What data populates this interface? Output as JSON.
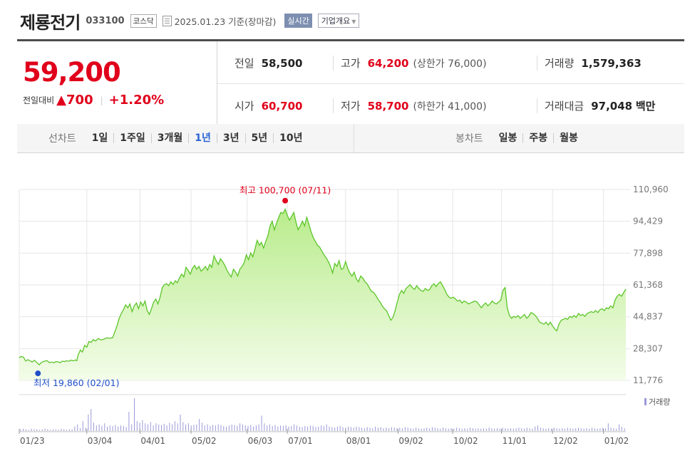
{
  "header": {
    "company": "제룡전기",
    "code": "033100",
    "market": "코스닥",
    "date": "2025.01.23 기준(장마감)",
    "realtime": "실시간",
    "company_info": "기업개요"
  },
  "quote": {
    "price": "59,200",
    "change_label": "전일대비",
    "change_value": "700",
    "change_pct": "+1.20%",
    "prev_close": {
      "label": "전일",
      "value": "58,500"
    },
    "high": {
      "label": "고가",
      "value": "64,200",
      "limit_label": "상한가",
      "limit_value": "76,000"
    },
    "volume": {
      "label": "거래량",
      "value": "1,579,363"
    },
    "open": {
      "label": "시가",
      "value": "60,700"
    },
    "low": {
      "label": "저가",
      "value": "58,700",
      "limit_label": "하한가",
      "limit_value": "41,000"
    },
    "amount": {
      "label": "거래대금",
      "value": "97,048",
      "unit": "백만"
    }
  },
  "periods": {
    "line_label": "선차트",
    "line_options": [
      "1일",
      "1주일",
      "3개월",
      "1년",
      "3년",
      "5년",
      "10년"
    ],
    "line_selected": 3,
    "candle_label": "봉차트",
    "candle_options": [
      "일봉",
      "주봉",
      "월봉"
    ]
  },
  "chart_data": {
    "type": "area",
    "x_ticks": [
      "01/23",
      "03/04",
      "04/01",
      "05/02",
      "06/03",
      "07/01",
      "08/01",
      "09/02",
      "10/02",
      "11/01",
      "12/02",
      "01/02"
    ],
    "y_ticks": [
      110960,
      94429,
      77898,
      61368,
      44837,
      28307,
      11776
    ],
    "ylim": [
      11776,
      110960
    ],
    "high_label": "최고 100,700 (07/11)",
    "low_label": "최저 19,860 (02/01)",
    "volume_label": "거래량",
    "colors": {
      "line": "#5cc52a",
      "fill_top": "#b9ec8c",
      "fill_bottom": "#f3fce9",
      "high": "#e0001b",
      "low": "#1f4fc9",
      "volume": "#9a9ad8",
      "grid": "#e6e6e6"
    },
    "points": [
      [
        0,
        23500
      ],
      [
        3,
        24200
      ],
      [
        6,
        23800
      ],
      [
        9,
        21800
      ],
      [
        12,
        22500
      ],
      [
        15,
        22000
      ],
      [
        18,
        21300
      ],
      [
        21,
        22200
      ],
      [
        24,
        21200
      ],
      [
        26,
        20400
      ],
      [
        28,
        19860
      ],
      [
        30,
        20800
      ],
      [
        33,
        21500
      ],
      [
        36,
        21800
      ],
      [
        39,
        22000
      ],
      [
        42,
        21000
      ],
      [
        45,
        21300
      ],
      [
        48,
        20900
      ],
      [
        51,
        21500
      ],
      [
        54,
        21400
      ],
      [
        57,
        21000
      ],
      [
        60,
        21800
      ],
      [
        63,
        21500
      ],
      [
        66,
        22000
      ],
      [
        69,
        21700
      ],
      [
        72,
        22300
      ],
      [
        75,
        21900
      ],
      [
        78,
        22400
      ],
      [
        80,
        22000
      ],
      [
        82,
        25000
      ],
      [
        85,
        27500
      ],
      [
        88,
        26500
      ],
      [
        91,
        30000
      ],
      [
        94,
        29000
      ],
      [
        97,
        32000
      ],
      [
        100,
        31500
      ],
      [
        103,
        33000
      ],
      [
        106,
        32200
      ],
      [
        110,
        33500
      ],
      [
        114,
        32800
      ],
      [
        118,
        33200
      ],
      [
        122,
        33900
      ],
      [
        126,
        33600
      ],
      [
        130,
        34000
      ],
      [
        133,
        37000
      ],
      [
        136,
        40000
      ],
      [
        139,
        44000
      ],
      [
        142,
        46500
      ],
      [
        145,
        48500
      ],
      [
        148,
        51000
      ],
      [
        151,
        49500
      ],
      [
        154,
        51500
      ],
      [
        157,
        47500
      ],
      [
        160,
        50500
      ],
      [
        163,
        52000
      ],
      [
        166,
        49000
      ],
      [
        169,
        52500
      ],
      [
        172,
        50500
      ],
      [
        175,
        53000
      ],
      [
        178,
        48000
      ],
      [
        181,
        46000
      ],
      [
        184,
        49000
      ],
      [
        187,
        52500
      ],
      [
        190,
        54000
      ],
      [
        193,
        51500
      ],
      [
        196,
        55000
      ],
      [
        199,
        60000
      ],
      [
        202,
        61500
      ],
      [
        205,
        62000
      ],
      [
        208,
        61000
      ],
      [
        211,
        63000
      ],
      [
        214,
        61500
      ],
      [
        217,
        63500
      ],
      [
        220,
        62500
      ],
      [
        223,
        65000
      ],
      [
        226,
        67000
      ],
      [
        229,
        65500
      ],
      [
        232,
        70500
      ],
      [
        235,
        69000
      ],
      [
        238,
        67000
      ],
      [
        241,
        70000
      ],
      [
        244,
        71500
      ],
      [
        247,
        69500
      ],
      [
        250,
        71000
      ],
      [
        253,
        68500
      ],
      [
        256,
        69500
      ],
      [
        259,
        71000
      ],
      [
        262,
        69000
      ],
      [
        265,
        72000
      ],
      [
        268,
        70500
      ],
      [
        271,
        76500
      ],
      [
        274,
        74000
      ],
      [
        277,
        72000
      ],
      [
        280,
        75000
      ],
      [
        283,
        73500
      ],
      [
        286,
        71500
      ],
      [
        289,
        69000
      ],
      [
        292,
        67000
      ],
      [
        295,
        65500
      ],
      [
        298,
        69500
      ],
      [
        301,
        68000
      ],
      [
        304,
        66000
      ],
      [
        307,
        69500
      ],
      [
        310,
        71000
      ],
      [
        313,
        73000
      ],
      [
        316,
        77000
      ],
      [
        319,
        74500
      ],
      [
        322,
        78000
      ],
      [
        325,
        76000
      ],
      [
        328,
        80000
      ],
      [
        331,
        84500
      ],
      [
        334,
        82000
      ],
      [
        337,
        83500
      ],
      [
        340,
        80500
      ],
      [
        343,
        84000
      ],
      [
        346,
        87000
      ],
      [
        349,
        92000
      ],
      [
        352,
        94500
      ],
      [
        355,
        90000
      ],
      [
        358,
        93500
      ],
      [
        361,
        96500
      ],
      [
        364,
        99000
      ],
      [
        367,
        98500
      ],
      [
        370,
        100700
      ],
      [
        373,
        97500
      ],
      [
        376,
        95000
      ],
      [
        379,
        97000
      ],
      [
        382,
        99000
      ],
      [
        385,
        94000
      ],
      [
        388,
        90000
      ],
      [
        391,
        92000
      ],
      [
        394,
        94500
      ],
      [
        397,
        92000
      ],
      [
        400,
        96500
      ],
      [
        403,
        93000
      ],
      [
        406,
        89000
      ],
      [
        409,
        86000
      ],
      [
        412,
        84000
      ],
      [
        415,
        82000
      ],
      [
        418,
        81000
      ],
      [
        421,
        79000
      ],
      [
        424,
        77000
      ],
      [
        427,
        75500
      ],
      [
        430,
        73500
      ],
      [
        433,
        71000
      ],
      [
        436,
        67500
      ],
      [
        439,
        72500
      ],
      [
        442,
        71000
      ],
      [
        445,
        74000
      ],
      [
        448,
        69500
      ],
      [
        451,
        70000
      ],
      [
        454,
        73500
      ],
      [
        457,
        70000
      ],
      [
        460,
        67500
      ],
      [
        463,
        66000
      ],
      [
        466,
        68000
      ],
      [
        469,
        64500
      ],
      [
        472,
        63000
      ],
      [
        475,
        66000
      ],
      [
        478,
        65000
      ],
      [
        481,
        63000
      ],
      [
        484,
        62000
      ],
      [
        487,
        60000
      ],
      [
        490,
        58000
      ],
      [
        493,
        57500
      ],
      [
        496,
        56000
      ],
      [
        499,
        54000
      ],
      [
        502,
        52500
      ],
      [
        505,
        50500
      ],
      [
        508,
        49000
      ],
      [
        511,
        48000
      ],
      [
        514,
        45500
      ],
      [
        517,
        43000
      ],
      [
        520,
        44500
      ],
      [
        523,
        48000
      ],
      [
        526,
        52500
      ],
      [
        529,
        56500
      ],
      [
        532,
        58500
      ],
      [
        535,
        57000
      ],
      [
        538,
        59500
      ],
      [
        541,
        60500
      ],
      [
        544,
        61500
      ],
      [
        547,
        60000
      ],
      [
        550,
        59000
      ],
      [
        553,
        61000
      ],
      [
        556,
        59500
      ],
      [
        559,
        58500
      ],
      [
        562,
        58000
      ],
      [
        565,
        59500
      ],
      [
        568,
        58500
      ],
      [
        571,
        59000
      ],
      [
        574,
        61000
      ],
      [
        577,
        62000
      ],
      [
        580,
        60500
      ],
      [
        583,
        62000
      ],
      [
        586,
        63000
      ],
      [
        589,
        61000
      ],
      [
        592,
        59000
      ],
      [
        595,
        56500
      ],
      [
        598,
        55000
      ],
      [
        601,
        54500
      ],
      [
        604,
        55000
      ],
      [
        607,
        54000
      ],
      [
        610,
        53000
      ],
      [
        613,
        53500
      ],
      [
        616,
        52000
      ],
      [
        619,
        53000
      ],
      [
        622,
        52500
      ],
      [
        625,
        51500
      ],
      [
        628,
        52000
      ],
      [
        631,
        52500
      ],
      [
        634,
        53000
      ],
      [
        637,
        52500
      ],
      [
        640,
        51000
      ],
      [
        643,
        49500
      ],
      [
        646,
        51000
      ],
      [
        649,
        52000
      ],
      [
        652,
        50500
      ],
      [
        655,
        51500
      ],
      [
        658,
        53000
      ],
      [
        661,
        52000
      ],
      [
        664,
        51500
      ],
      [
        667,
        52500
      ],
      [
        670,
        53500
      ],
      [
        673,
        58500
      ],
      [
        676,
        60000
      ],
      [
        679,
        49500
      ],
      [
        682,
        45500
      ],
      [
        685,
        44000
      ],
      [
        688,
        45000
      ],
      [
        691,
        44500
      ],
      [
        694,
        45500
      ],
      [
        697,
        44000
      ],
      [
        700,
        45000
      ],
      [
        703,
        46000
      ],
      [
        706,
        44000
      ],
      [
        709,
        45000
      ],
      [
        712,
        47000
      ],
      [
        715,
        46500
      ],
      [
        718,
        45500
      ],
      [
        721,
        44000
      ],
      [
        724,
        42000
      ],
      [
        727,
        41500
      ],
      [
        730,
        41000
      ],
      [
        733,
        42000
      ],
      [
        736,
        40500
      ],
      [
        739,
        42000
      ],
      [
        742,
        40000
      ],
      [
        745,
        38500
      ],
      [
        748,
        37500
      ],
      [
        751,
        41000
      ],
      [
        754,
        43000
      ],
      [
        757,
        43500
      ],
      [
        760,
        44000
      ],
      [
        763,
        43500
      ],
      [
        766,
        45000
      ],
      [
        769,
        44500
      ],
      [
        772,
        45500
      ],
      [
        775,
        44500
      ],
      [
        778,
        46500
      ],
      [
        781,
        45500
      ],
      [
        784,
        46000
      ],
      [
        787,
        45000
      ],
      [
        790,
        46500
      ],
      [
        793,
        47000
      ],
      [
        796,
        47500
      ],
      [
        799,
        47000
      ],
      [
        802,
        48000
      ],
      [
        805,
        47000
      ],
      [
        808,
        48500
      ],
      [
        811,
        49000
      ],
      [
        814,
        48000
      ],
      [
        817,
        49500
      ],
      [
        820,
        49000
      ],
      [
        823,
        50500
      ],
      [
        826,
        49500
      ],
      [
        829,
        53500
      ],
      [
        832,
        55500
      ],
      [
        835,
        56500
      ],
      [
        838,
        55500
      ],
      [
        841,
        57500
      ],
      [
        844,
        59200
      ]
    ],
    "volumes": [
      3,
      4,
      3,
      2,
      4,
      3,
      3,
      2,
      3,
      4,
      3,
      2,
      3,
      3,
      2,
      4,
      3,
      2,
      3,
      3,
      8,
      12,
      5,
      18,
      6,
      30,
      40,
      15,
      10,
      12,
      9,
      14,
      8,
      10,
      9,
      11,
      8,
      10,
      9,
      7,
      35,
      12,
      60,
      18,
      15,
      20,
      14,
      12,
      16,
      10,
      14,
      12,
      11,
      13,
      10,
      15,
      12,
      18,
      14,
      30,
      16,
      12,
      14,
      10,
      11,
      12,
      22,
      15,
      10,
      12,
      9,
      11,
      10,
      12,
      11,
      9,
      8,
      10,
      12,
      11,
      9,
      14,
      12,
      10,
      9,
      11,
      8,
      10,
      12,
      28,
      14,
      10,
      12,
      9,
      11,
      8,
      10,
      9,
      10,
      8,
      9,
      12,
      10,
      8,
      7,
      9,
      8,
      10,
      9,
      7,
      8,
      10,
      9,
      12,
      8,
      7,
      6,
      8,
      9,
      7,
      6,
      8,
      7,
      6,
      8,
      7,
      6,
      5,
      7,
      6,
      5,
      8,
      6,
      7,
      5,
      6,
      5,
      7,
      6,
      5,
      6,
      5,
      7,
      6,
      5,
      4,
      6,
      5,
      4,
      5,
      6,
      5,
      7,
      6,
      5,
      4,
      6,
      5,
      4,
      5,
      4,
      6,
      5,
      4,
      5,
      4,
      6,
      5,
      4,
      5,
      4,
      5,
      4,
      6,
      5,
      4,
      5,
      4,
      6,
      5,
      4,
      5,
      4,
      5,
      6,
      5,
      4,
      6,
      5,
      4,
      8,
      10,
      6,
      5,
      4,
      5,
      4,
      6,
      5,
      4,
      5,
      4,
      6,
      5,
      4,
      5,
      6,
      5,
      4,
      5,
      4,
      6,
      5,
      4,
      5,
      6,
      5,
      14,
      6,
      5,
      4,
      12,
      8,
      5
    ]
  }
}
